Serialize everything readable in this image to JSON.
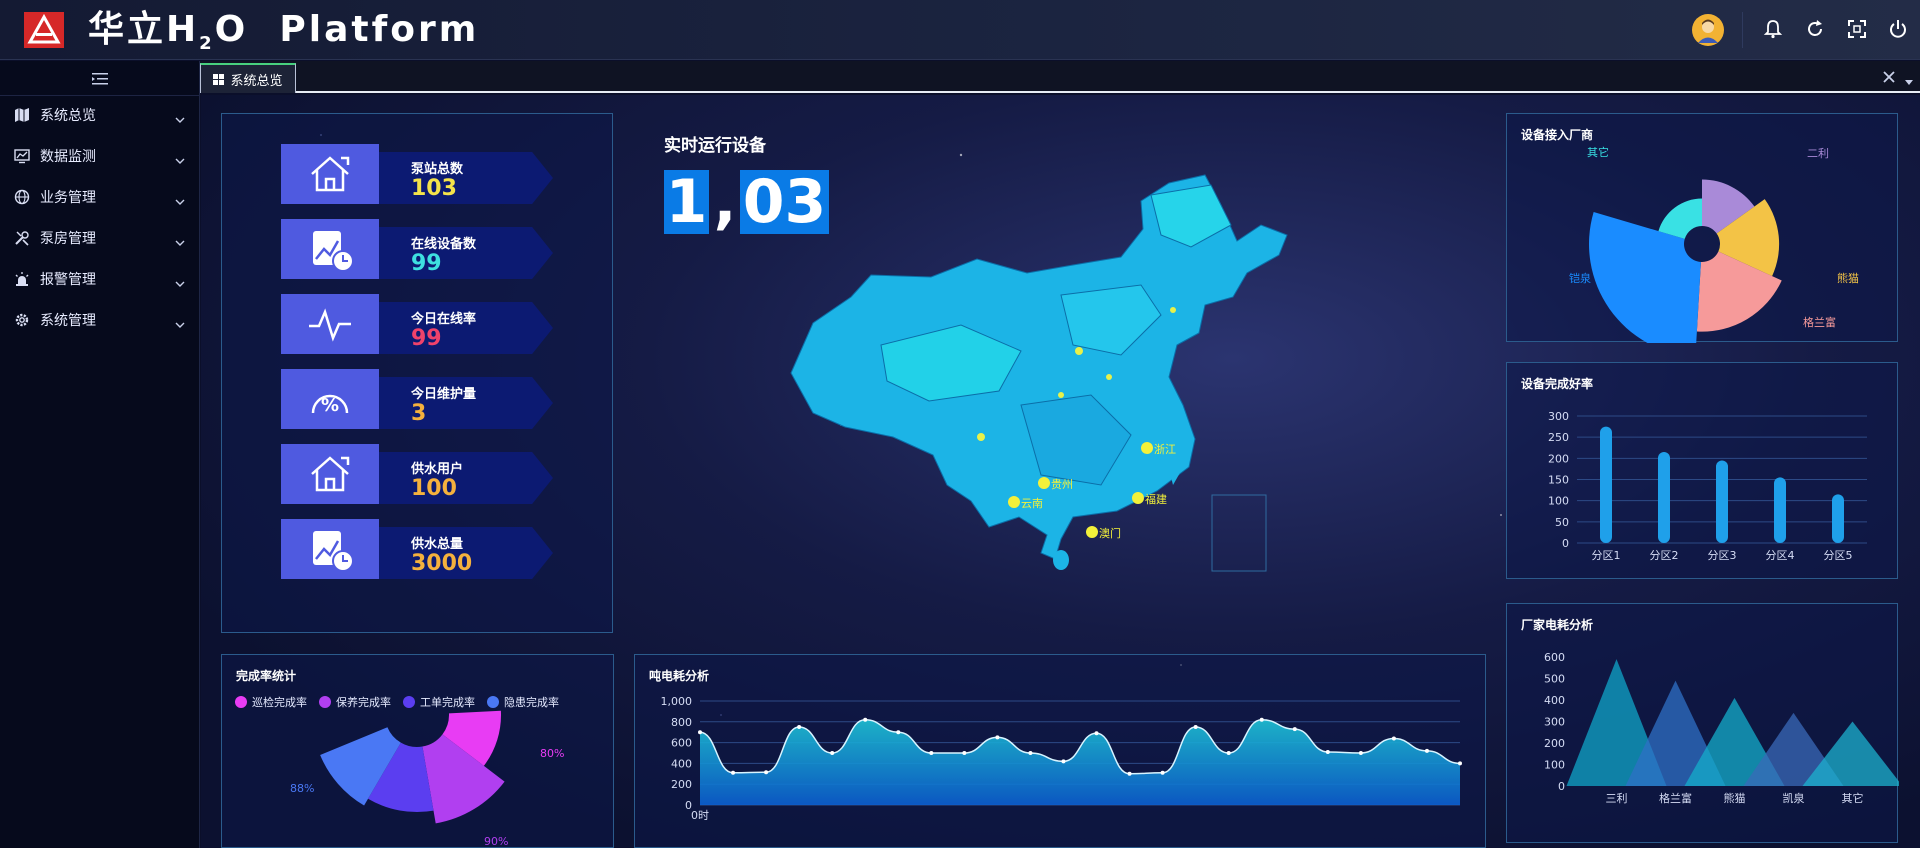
{
  "header": {
    "title_main": "华立H",
    "title_sub": "2",
    "title_end": "O  Platform"
  },
  "sidebar": {
    "items": [
      {
        "label": "系统总览",
        "icon": "map-icon"
      },
      {
        "label": "数据监测",
        "icon": "monitor-chart-icon"
      },
      {
        "label": "业务管理",
        "icon": "globe-icon"
      },
      {
        "label": "泵房管理",
        "icon": "tools-icon"
      },
      {
        "label": "报警管理",
        "icon": "alarm-light-icon"
      },
      {
        "label": "系统管理",
        "icon": "gear-icon"
      }
    ]
  },
  "tabs": [
    {
      "label": "系统总览"
    }
  ],
  "stats": [
    {
      "label": "泵站总数",
      "value": "103",
      "color": "#f5e34a",
      "icon": "home-icon"
    },
    {
      "label": "在线设备数",
      "value": "99",
      "color": "#3ee0e0",
      "icon": "chart-clock-icon"
    },
    {
      "label": "今日在线率",
      "value": "99",
      "color": "#f0426b",
      "icon": "pulse-icon"
    },
    {
      "label": "今日维护量",
      "value": "3",
      "color": "#f5b13d",
      "icon": "gauge-percent-icon"
    },
    {
      "label": "供水用户",
      "value": "100",
      "color": "#f5b13d",
      "icon": "home-icon"
    },
    {
      "label": "供水总量",
      "value": "3000",
      "color": "#f5b13d",
      "icon": "chart-clock-icon"
    }
  ],
  "realtime": {
    "title": "实时运行设备",
    "digits": [
      "1",
      ",",
      "03"
    ]
  },
  "map": {
    "labels": [
      "浙江",
      "福建",
      "贵州",
      "云南",
      "澳门"
    ]
  },
  "panels": {
    "vendor_title": "设备接入厂商",
    "rate_title": "设备完成好率",
    "energy_title": "厂家电耗分析",
    "completion_title": "完成率统计",
    "ton_title": "吨电耗分析"
  },
  "colors": {
    "accent": "#0a7be6",
    "panel_border": "#2b5b8c",
    "tab_active": "#48d07f"
  },
  "chart_data": [
    {
      "type": "pie",
      "title": "设备接入厂商",
      "categories": [
        "二利",
        "熊猫",
        "格兰富",
        "铠泉",
        "其它"
      ],
      "values": [
        22,
        28,
        33,
        45,
        13
      ],
      "colors": [
        "#a98ad8",
        "#f3c346",
        "#f69a9a",
        "#1a8cff",
        "#39e1e4"
      ]
    },
    {
      "type": "bar",
      "title": "设备完成好率",
      "categories": [
        "分区1",
        "分区2",
        "分区3",
        "分区4",
        "分区5"
      ],
      "values": [
        275,
        215,
        195,
        155,
        115
      ],
      "y_ticks": [
        "0",
        "50",
        "100",
        "150",
        "200",
        "250",
        "300"
      ],
      "ylim": [
        0,
        300
      ]
    },
    {
      "type": "area",
      "title": "厂家电耗分析",
      "categories": [
        "三利",
        "格兰富",
        "熊猫",
        "凯泉",
        "其它"
      ],
      "values": [
        590,
        490,
        410,
        340,
        300
      ],
      "y_ticks": [
        "0",
        "100",
        "200",
        "300",
        "400",
        "500",
        "600"
      ],
      "ylim": [
        0,
        600
      ]
    },
    {
      "type": "pie",
      "title": "完成率统计",
      "categories": [
        "巡检完成率",
        "保养完成率",
        "工单完成率",
        "隐患完成率"
      ],
      "values": [
        80,
        90,
        85,
        88
      ],
      "value_labels": [
        "80%",
        "90%",
        "",
        "88%"
      ],
      "colors": [
        "#e83cf4",
        "#b13ff0",
        "#5b3ef0",
        "#4a78f4"
      ]
    },
    {
      "type": "area",
      "title": "吨电耗分析",
      "x_first_label": "0时",
      "values": [
        700,
        310,
        315,
        750,
        500,
        820,
        700,
        500,
        500,
        650,
        500,
        420,
        690,
        300,
        310,
        750,
        500,
        820,
        730,
        510,
        500,
        640,
        520,
        400
      ],
      "y_ticks": [
        "0",
        "200",
        "400",
        "600",
        "800",
        "1,000"
      ],
      "ylim": [
        0,
        1000
      ]
    }
  ]
}
